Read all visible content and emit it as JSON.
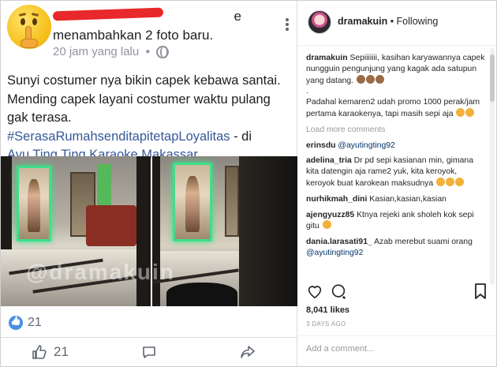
{
  "facebook": {
    "headline_suffix": "e menambahkan 2 foto baru.",
    "timestamp": "20 jam yang lalu",
    "post_line1": "Sunyi costumer nya bikin capek kebawa santai.",
    "post_line2": "Mending capek layani costumer waktu pulang gak terasa.",
    "hashtag": "#SerasaRumahsenditapitetapLoyalitas",
    "connector": " - di ",
    "location": "Ayu Ting Ting Karaoke Makassar",
    "period": ".",
    "watermark": "@dramakuin",
    "reaction_count": "21",
    "like_count": "21",
    "icons": [
      "globe-icon",
      "more-vert-icon",
      "like-badge-icon",
      "thumb-up-icon",
      "comment-icon",
      "share-icon"
    ]
  },
  "instagram": {
    "username": "dramakuin",
    "separator": " • ",
    "follow_status": "Following",
    "caption_user": "dramakuin",
    "caption_text": "Sepiiiiiii, kasihan karyawannya capek nungguin pengunjung yang kagak ada satupun yang datang.",
    "caption_dot": ".",
    "caption_text2": "Padahal kemaren2 udah promo 1000 perak/jam pertama karaokenya, tapi masih sepi aja",
    "load_more": "Load more comments",
    "comments": [
      {
        "user": "erinsdu",
        "text": "",
        "mention": "@ayutingting92"
      },
      {
        "user": "adelina_tria",
        "text": "Dr pd sepi kasianan min, gimana kita datengin aja rame2 yuk, kita keroyok, keroyok buat karokean maksudnya",
        "mention": ""
      },
      {
        "user": "nurhikmah_dini",
        "text": "Kasian,kasian,kasian",
        "mention": ""
      },
      {
        "user": "ajengyuzz85",
        "text": "Ktnya rejeki ank sholeh kok sepi gitu",
        "mention": ""
      },
      {
        "user": "dania.larasati91_",
        "text": "Azab merebut suami orang",
        "mention": "@ayutingting92"
      }
    ],
    "likes": "8,041 likes",
    "date": "3 DAYS AGO",
    "comment_placeholder": "Add a comment...",
    "icons": [
      "heart-icon",
      "comment-bubble-icon",
      "bookmark-icon"
    ]
  }
}
